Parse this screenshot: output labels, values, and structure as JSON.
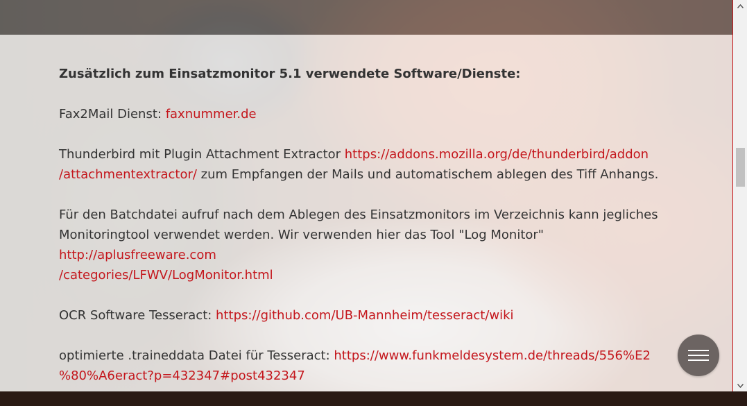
{
  "content": {
    "heading": "Zusätzlich zum Einsatzmonitor 5.1 verwendete Software/Dienste:",
    "fax": {
      "text": "Fax2Mail Dienst: ",
      "link": "faxnummer.de"
    },
    "thunderbird": {
      "text": "Thunderbird mit Plugin Attachment Extractor ",
      "link_line1": "https://addons.mozilla.org/de/thunderbird/addon",
      "link_line2": "/attachmentextractor/",
      "text_after": " zum Empfangen der Mails und automatischem ablegen des Tiff Anhangs."
    },
    "batch": {
      "text_line1": "Für den Batchdatei aufruf nach dem Ablegen des Einsatzmonitors im Verzeichnis kann jegliches",
      "text_line2": "Monitoringtool verwendet werden. Wir verwenden hier das Tool \"Log Monitor\" ",
      "link_line1": "http://aplusfreeware.com",
      "link_line2": "/categories/LFWV/LogMonitor.html"
    },
    "ocr": {
      "text": "OCR Software Tesseract: ",
      "link": "https://github.com/UB-Mannheim/tesseract/wiki"
    },
    "traineddata": {
      "text": "optimierte .traineddata Datei für Tesseract: ",
      "link_line1": "https://www.funkmeldesystem.de/threads/556%E2",
      "link_line2": "%80%A6eract?p=432347#post432347"
    }
  },
  "scrollbar": {
    "up_icon": "chevron-up-icon",
    "down_icon": "chevron-down-icon"
  },
  "menu_button": {
    "icon": "hamburger-menu-icon"
  },
  "colors": {
    "link": "#c4161c",
    "text": "#333333",
    "menu_button_bg": "#6c6462"
  }
}
